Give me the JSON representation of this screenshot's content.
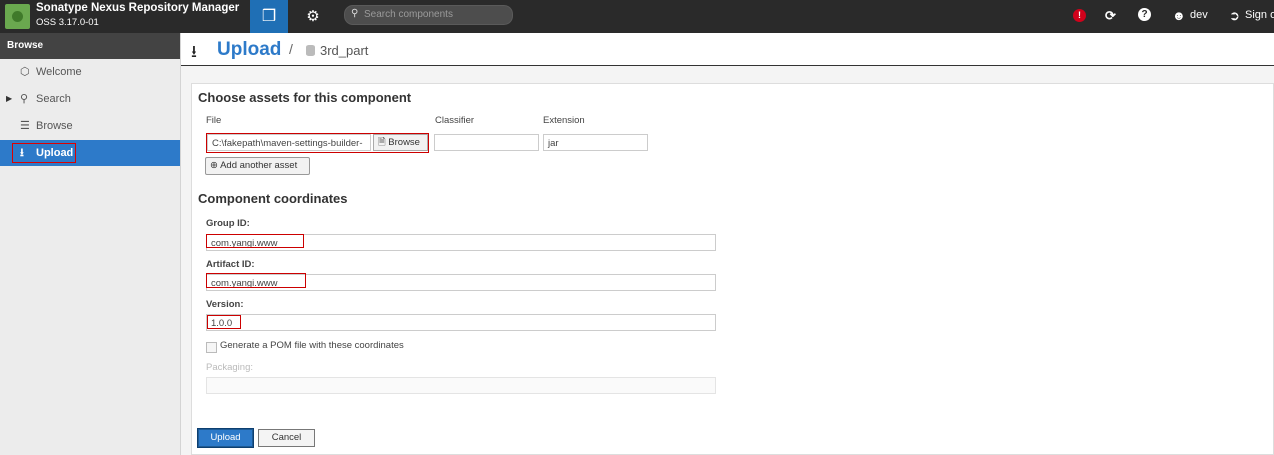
{
  "header": {
    "title": "Sonatype Nexus Repository Manager",
    "version": "OSS 3.17.0-01",
    "search_placeholder": "Search components",
    "alert_badge": "!",
    "help_symbol": "?",
    "user": "dev",
    "signout": "Sign out",
    "icons": [
      "cube-icon",
      "gear-icon",
      "search-icon",
      "alert-icon",
      "refresh-icon",
      "help-icon",
      "user-icon",
      "signout-icon"
    ]
  },
  "sidebar": {
    "header": "Browse",
    "items": [
      {
        "label": "Welcome",
        "icon": "hexagon-icon"
      },
      {
        "label": "Search",
        "icon": "search-icon"
      },
      {
        "label": "Browse",
        "icon": "database-icon"
      },
      {
        "label": "Upload",
        "icon": "upload-icon",
        "active": true
      }
    ]
  },
  "breadcrumb": {
    "title": "Upload",
    "separator": "/",
    "repository": "3rd_part"
  },
  "form": {
    "assets_title": "Choose assets for this component",
    "file_label": "File",
    "file_value": "C:\\fakepath\\maven-settings-builder-",
    "browse_label": "Browse",
    "classifier_label": "Classifier",
    "classifier_value": "",
    "extension_label": "Extension",
    "extension_value": "jar",
    "add_asset_label": "Add another asset",
    "coords_title": "Component coordinates",
    "group_label": "Group ID:",
    "group_value": "com.yangi.www",
    "artifact_label": "Artifact ID:",
    "artifact_value": "com.yangi.www",
    "version_label": "Version:",
    "version_value": "1.0.0",
    "pom_label": "Generate a POM file with these coordinates",
    "pom_checked": false,
    "packaging_label": "Packaging:",
    "packaging_value": "",
    "upload_label": "Upload",
    "cancel_label": "Cancel"
  },
  "colors": {
    "accent": "#2d7ac9",
    "topbar": "#2a2a2a",
    "highlight": "#cc0000"
  }
}
